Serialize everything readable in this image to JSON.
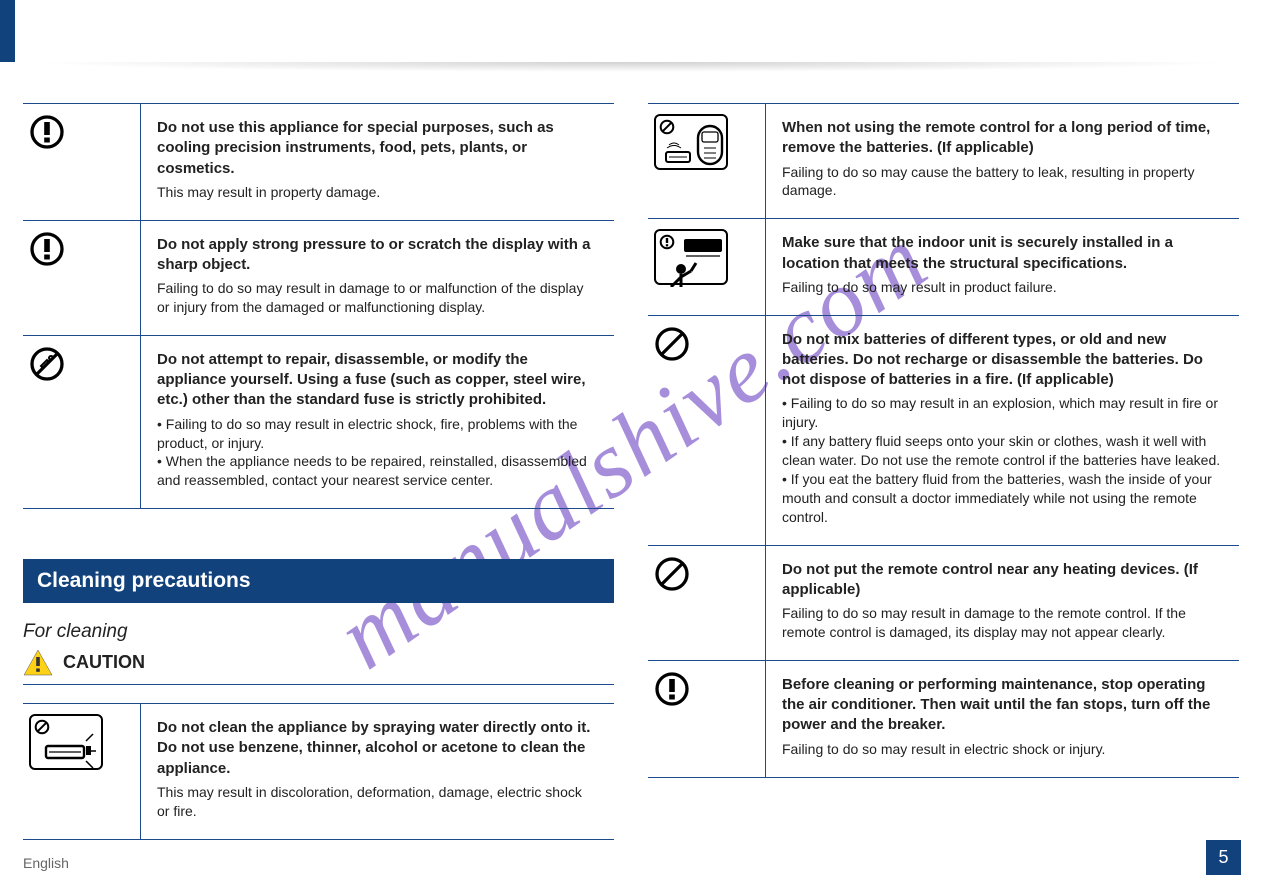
{
  "watermark": "manualshive.com",
  "footer": "English",
  "pageNumber": "5",
  "section1": {
    "rows": [
      {
        "lead": "Do not use this appliance for special purposes, such as cooling precision instruments, food, pets, plants, or cosmetics.",
        "sub": "This may result in property damage."
      },
      {
        "lead": "Do not apply strong pressure to or scratch the display with a sharp object.",
        "sub": "Failing to do so may result in damage to or malfunction of the display or injury from the damaged or malfunctioning display."
      },
      {
        "lead": "Do not attempt to repair, disassemble, or modify the appliance yourself. Using a fuse (such as copper, steel wire, etc.) other than the standard fuse is strictly prohibited.",
        "sub": "• Failing to do so may result in electric shock, fire, problems with the product, or injury.\n• When the appliance needs to be repaired, reinstalled, disassembled and reassembled, contact your nearest service center."
      }
    ]
  },
  "section2": {
    "title": "Cleaning precautions",
    "subtitle": "For cleaning",
    "caution": "CAUTION",
    "rows": [
      {
        "lead": "Do not clean the appliance by spraying water directly onto it. Do not use benzene, thinner, alcohol or acetone to clean the appliance.",
        "sub": "This may result in discoloration, deformation, damage, electric shock or fire."
      }
    ]
  },
  "rightRows": [
    {
      "lead": "When not using the remote control for a long period of time, remove the batteries. (If applicable)",
      "sub": "Failing to do so may cause the battery to leak, resulting in property damage."
    },
    {
      "lead": "Make sure that the indoor unit is securely installed in a location that meets the structural specifications.",
      "sub": "Failing to do so may result in product failure."
    },
    {
      "lead": "Do not mix batteries of different types, or old and new batteries. Do not recharge or disassemble the batteries. Do not dispose of batteries in a fire. (If applicable)",
      "sub": "• Failing to do so may result in an explosion, which may result in fire or injury.\n• If any battery fluid seeps onto your skin or clothes, wash it well with clean water. Do not use the remote control if the batteries have leaked.\n• If you eat the battery fluid from the batteries, wash the inside of your mouth and consult a doctor immediately while not using the remote control."
    },
    {
      "lead": "Do not put the remote control near any heating devices. (If applicable)",
      "sub": "Failing to do so may result in damage to the remote control. If the remote control is damaged, its display may not appear clearly."
    },
    {
      "lead": "Before cleaning or performing maintenance, stop operating the air conditioner. Then wait until the fan stops, turn off the power and the breaker.",
      "sub": "Failing to do so may result in electric shock or injury."
    }
  ]
}
